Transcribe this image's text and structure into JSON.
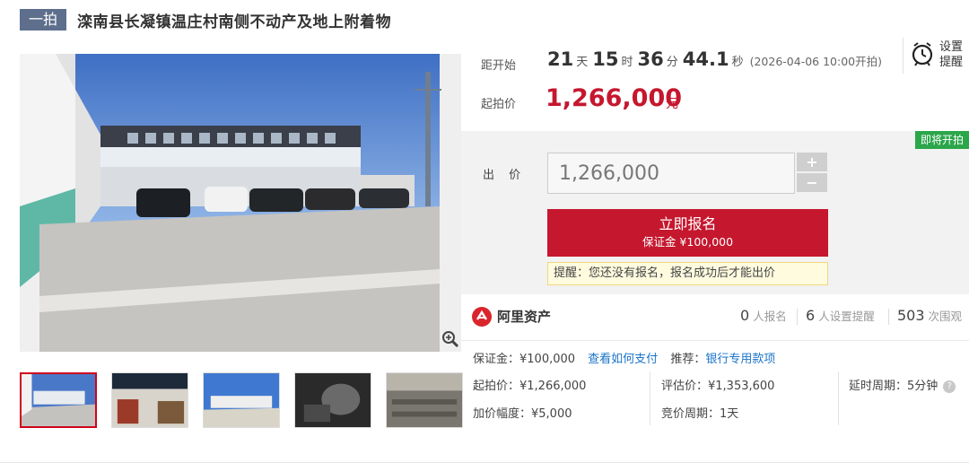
{
  "header": {
    "tag": "一拍",
    "title": "滦南县长凝镇温庄村南侧不动产及地上附着物"
  },
  "countdown": {
    "label": "距开始",
    "days": "21",
    "days_unit": "天",
    "hours": "15",
    "hours_unit": "时",
    "minutes": "36",
    "minutes_unit": "分",
    "seconds": "44.1",
    "seconds_unit": "秒",
    "start_note": "(2026-04-06 10:00开拍)"
  },
  "start_price": {
    "label": "起拍价",
    "value": "1,266,000",
    "unit": "元"
  },
  "reminder": {
    "label_line1": "设置",
    "label_line2": "提醒",
    "icon": "alarm-clock-icon"
  },
  "bid": {
    "badge": "即将开拍",
    "label": "出 价",
    "input_value": "1,266,000",
    "plus": "+",
    "minus": "−",
    "signup_label": "立即报名",
    "deposit_label": "保证金 ¥100,000",
    "tip": "提醒：您还没有报名，报名成功后才能出价"
  },
  "platform": {
    "name": "阿里资产",
    "icon": "alibaba-asset-logo-icon"
  },
  "stats": {
    "registered_num": "0",
    "registered_txt": "人报名",
    "reminders_num": "6",
    "reminders_txt": "人设置提醒",
    "views_num": "503",
    "views_txt": "次围观"
  },
  "details": {
    "deposit": "保证金：¥100,000",
    "how_to_pay": "查看如何支付",
    "recommend_label": "推荐：",
    "recommend_link": "银行专用款项",
    "start_price": "起拍价：¥1,266,000",
    "appraisal": "评估价：¥1,353,600",
    "delay": "延时周期：5分钟",
    "increment": "加价幅度：¥5,000",
    "bid_period": "竞价周期：1天"
  },
  "colors": {
    "accent_red": "#c5172e",
    "tag_bg": "#5d6f8c",
    "badge_green": "#2ba64a",
    "link_blue": "#1a73c9"
  }
}
